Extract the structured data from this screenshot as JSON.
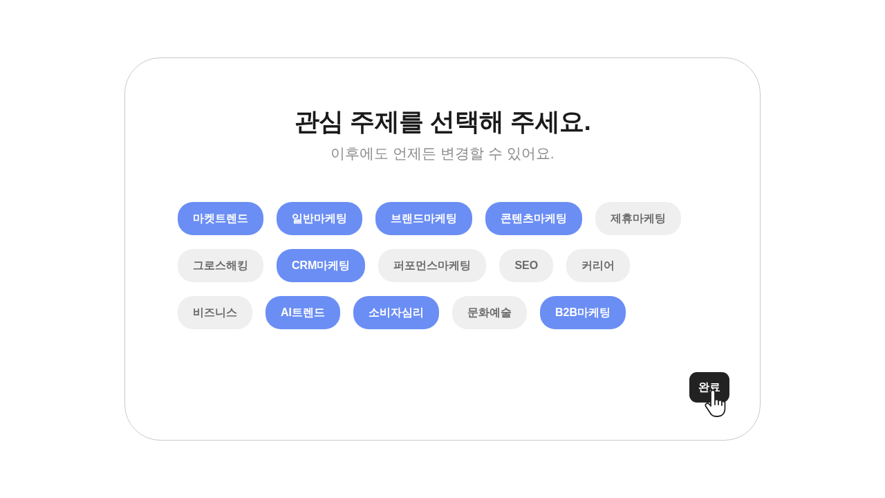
{
  "dialog": {
    "title": "관심 주제를 선택해 주세요.",
    "subtitle": "이후에도 언제든 변경할 수 있어요.",
    "topic_rows": [
      {
        "topics": [
          {
            "label": "마켓트렌드",
            "selected": true
          },
          {
            "label": "일반마케팅",
            "selected": true
          },
          {
            "label": "브랜드마케팅",
            "selected": true
          },
          {
            "label": "콘텐츠마케팅",
            "selected": true
          },
          {
            "label": "제휴마케팅",
            "selected": false
          }
        ]
      },
      {
        "topics": [
          {
            "label": "그로스해킹",
            "selected": false
          },
          {
            "label": "CRM마케팅",
            "selected": true
          },
          {
            "label": "퍼포먼스마케팅",
            "selected": false
          },
          {
            "label": "SEO",
            "selected": false
          },
          {
            "label": "커리어",
            "selected": false
          }
        ]
      },
      {
        "topics": [
          {
            "label": "비즈니스",
            "selected": false
          },
          {
            "label": "AI트렌드",
            "selected": true
          },
          {
            "label": "소비자심리",
            "selected": true
          },
          {
            "label": "문화예술",
            "selected": false
          },
          {
            "label": "B2B마케팅",
            "selected": true
          }
        ]
      }
    ],
    "done_button": {
      "label": "완료"
    }
  }
}
